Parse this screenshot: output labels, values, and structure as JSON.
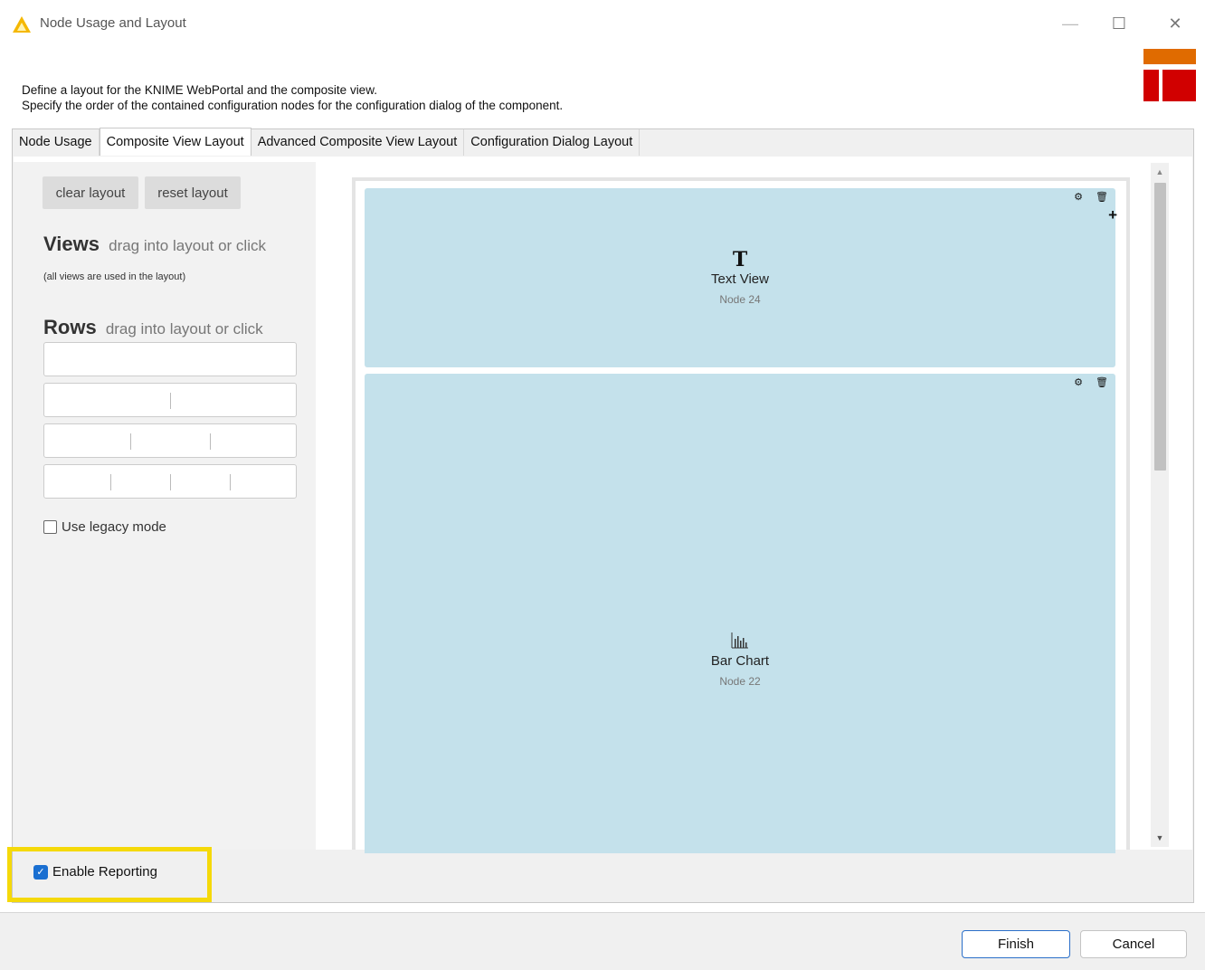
{
  "window": {
    "title": "Node Usage and Layout",
    "minimize": "—",
    "maximize": "☐",
    "close": "✕"
  },
  "header": {
    "line1": "Define a layout for the KNIME WebPortal and the composite view.",
    "line2": "Specify the order of the contained configuration nodes for the configuration dialog of the component."
  },
  "tabs": [
    {
      "label": "Node Usage"
    },
    {
      "label": "Composite View Layout",
      "active": true
    },
    {
      "label": "Advanced Composite View Layout"
    },
    {
      "label": "Configuration Dialog Layout"
    }
  ],
  "left": {
    "clear_label": "clear layout",
    "reset_label": "reset layout",
    "views_title": "Views",
    "views_hint": "drag into layout or click",
    "views_note": "(all views are used in the layout)",
    "rows_title": "Rows",
    "rows_hint": "drag into layout or click",
    "legacy_label": "Use legacy mode"
  },
  "layout": {
    "cells": [
      {
        "icon": "T",
        "name": "Text View",
        "node": "Node 24"
      },
      {
        "icon": "📊",
        "name": "Bar Chart",
        "node": "Node 22"
      }
    ],
    "settings_glyph": "⚙",
    "delete_glyph": "🗑",
    "add_glyph": "+"
  },
  "scroll": {
    "up": "▲",
    "down": "▼"
  },
  "reporting": {
    "label": "Enable Reporting",
    "checked": true,
    "check_glyph": "✓"
  },
  "footer": {
    "finish_label": "Finish",
    "cancel_label": "Cancel"
  },
  "colors": {
    "accent": "#1a6fd1",
    "cell": "#c4e1eb",
    "highlight": "#f5d90a"
  }
}
